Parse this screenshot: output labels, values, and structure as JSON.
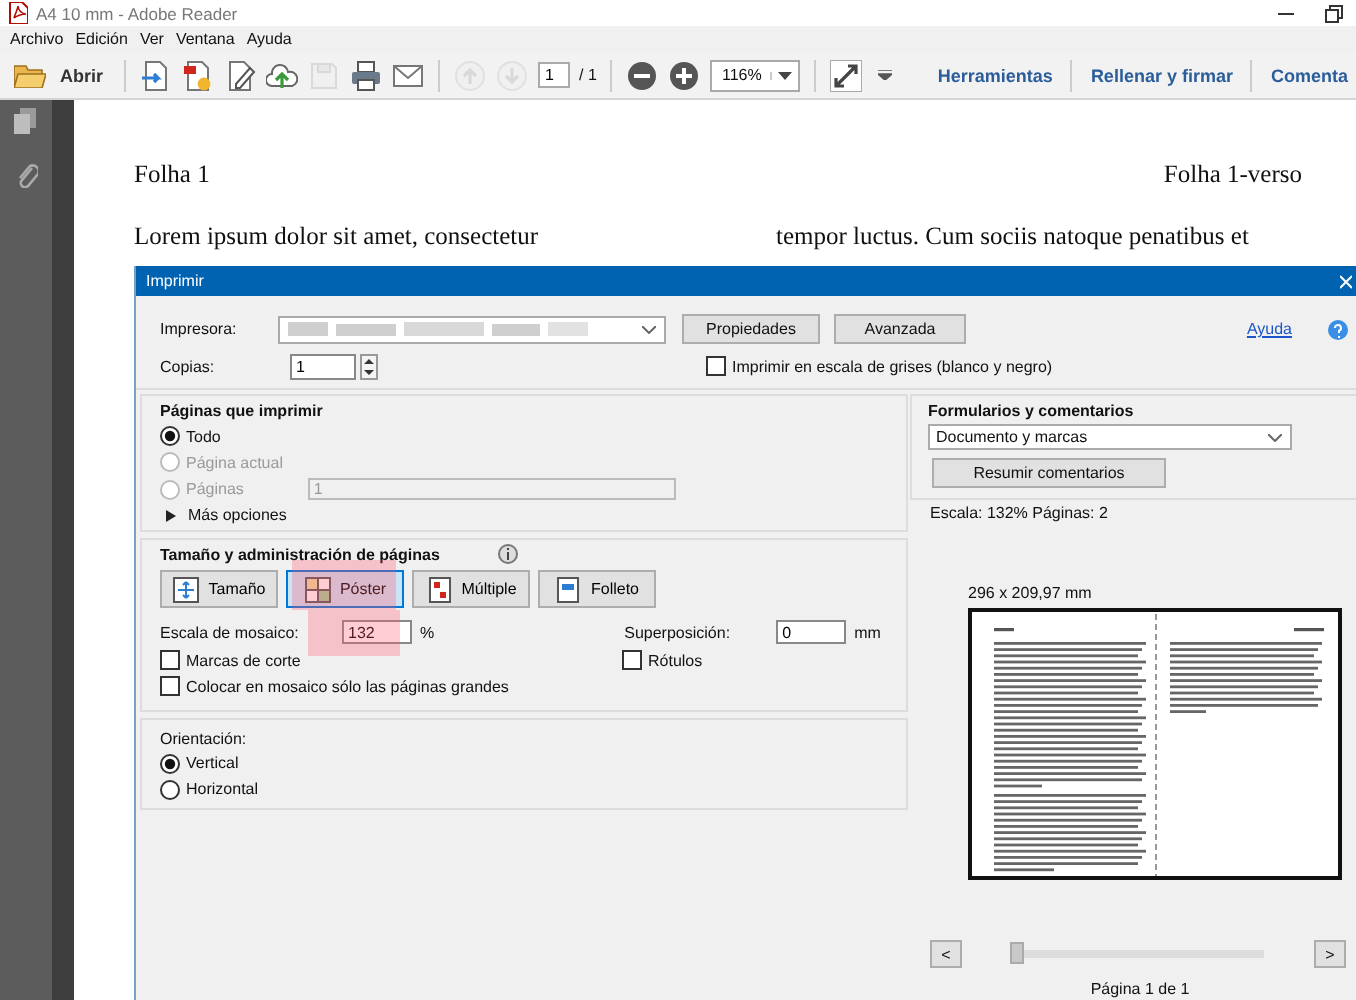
{
  "window": {
    "title": "A4 10 mm - Adobe Reader"
  },
  "menu": [
    "Archivo",
    "Edición",
    "Ver",
    "Ventana",
    "Ayuda"
  ],
  "toolbar": {
    "open_label": "Abrir",
    "tools": [
      {
        "kind": "export",
        "disabled": false
      },
      {
        "kind": "create",
        "disabled": false
      },
      {
        "kind": "edit",
        "disabled": false
      },
      {
        "kind": "upload",
        "disabled": false
      },
      {
        "kind": "save",
        "disabled": true
      },
      {
        "kind": "print",
        "disabled": false
      },
      {
        "kind": "email",
        "disabled": false
      }
    ],
    "nav": [
      {
        "kind": "up",
        "disabled": true
      },
      {
        "kind": "down",
        "disabled": true
      }
    ],
    "page_value": "1",
    "page_total": "/ 1",
    "zoom": "116%",
    "panels": [
      "Herramientas",
      "Rellenar y firmar",
      "Comenta"
    ]
  },
  "document": {
    "header_left": "Folha 1",
    "header_right": "Folha 1-verso",
    "column_1": "Lorem ipsum dolor sit amet, consectetur",
    "column_2": "tempor luctus. Cum sociis natoque penatibus et"
  },
  "dialog": {
    "title": "Imprimir",
    "printer_label": "Impresora:",
    "properties_button": "Propiedades",
    "advanced_button": "Avanzada",
    "help_link": "Ayuda",
    "copies_label": "Copias:",
    "copies": "1",
    "grayscale": {
      "label": "Imprimir en escala de grises (blanco y negro)",
      "checked": false
    },
    "pages": {
      "title": "Páginas que imprimir",
      "options": [
        {
          "label": "Todo",
          "selected": true,
          "disabled": false
        },
        {
          "label": "Página actual",
          "selected": false,
          "disabled": true
        },
        {
          "label": "Páginas",
          "selected": false,
          "disabled": true
        }
      ],
      "range": "1",
      "more": "Más opciones",
      "more_expanded": false
    },
    "sizing": {
      "title": "Tamaño y administración de páginas",
      "modes": [
        {
          "kind": "fit",
          "label": "Tamaño",
          "selected": false
        },
        {
          "kind": "poster",
          "label": "Póster",
          "selected": true
        },
        {
          "kind": "multiple",
          "label": "Múltiple",
          "selected": false
        },
        {
          "kind": "booklet",
          "label": "Folleto",
          "selected": false
        }
      ],
      "tile_scale_label": "Escala de mosaico:",
      "tile_scale": "132",
      "percent": "%",
      "overlap_label": "Superposición:",
      "overlap": "0",
      "unit": "mm",
      "options": [
        {
          "label": "Marcas de corte",
          "checked": false
        },
        {
          "label": "Rótulos",
          "checked": false
        },
        {
          "label": "Colocar en mosaico sólo las páginas grandes",
          "checked": false
        }
      ]
    },
    "orientation": {
      "label": "Orientación:",
      "options": [
        {
          "label": "Vertical",
          "selected": true
        },
        {
          "label": "Horizontal",
          "selected": false
        }
      ]
    },
    "comments": {
      "title": "Formularios y comentarios",
      "value": "Documento y marcas",
      "summarize": "Resumir comentarios"
    },
    "preview": {
      "summary": "Escala: 132% Páginas: 2",
      "size": "296 x 209,97 mm",
      "prev": "<",
      "next": ">",
      "page": "Página 1 de 1",
      "slider": {
        "level": 0
      }
    }
  }
}
